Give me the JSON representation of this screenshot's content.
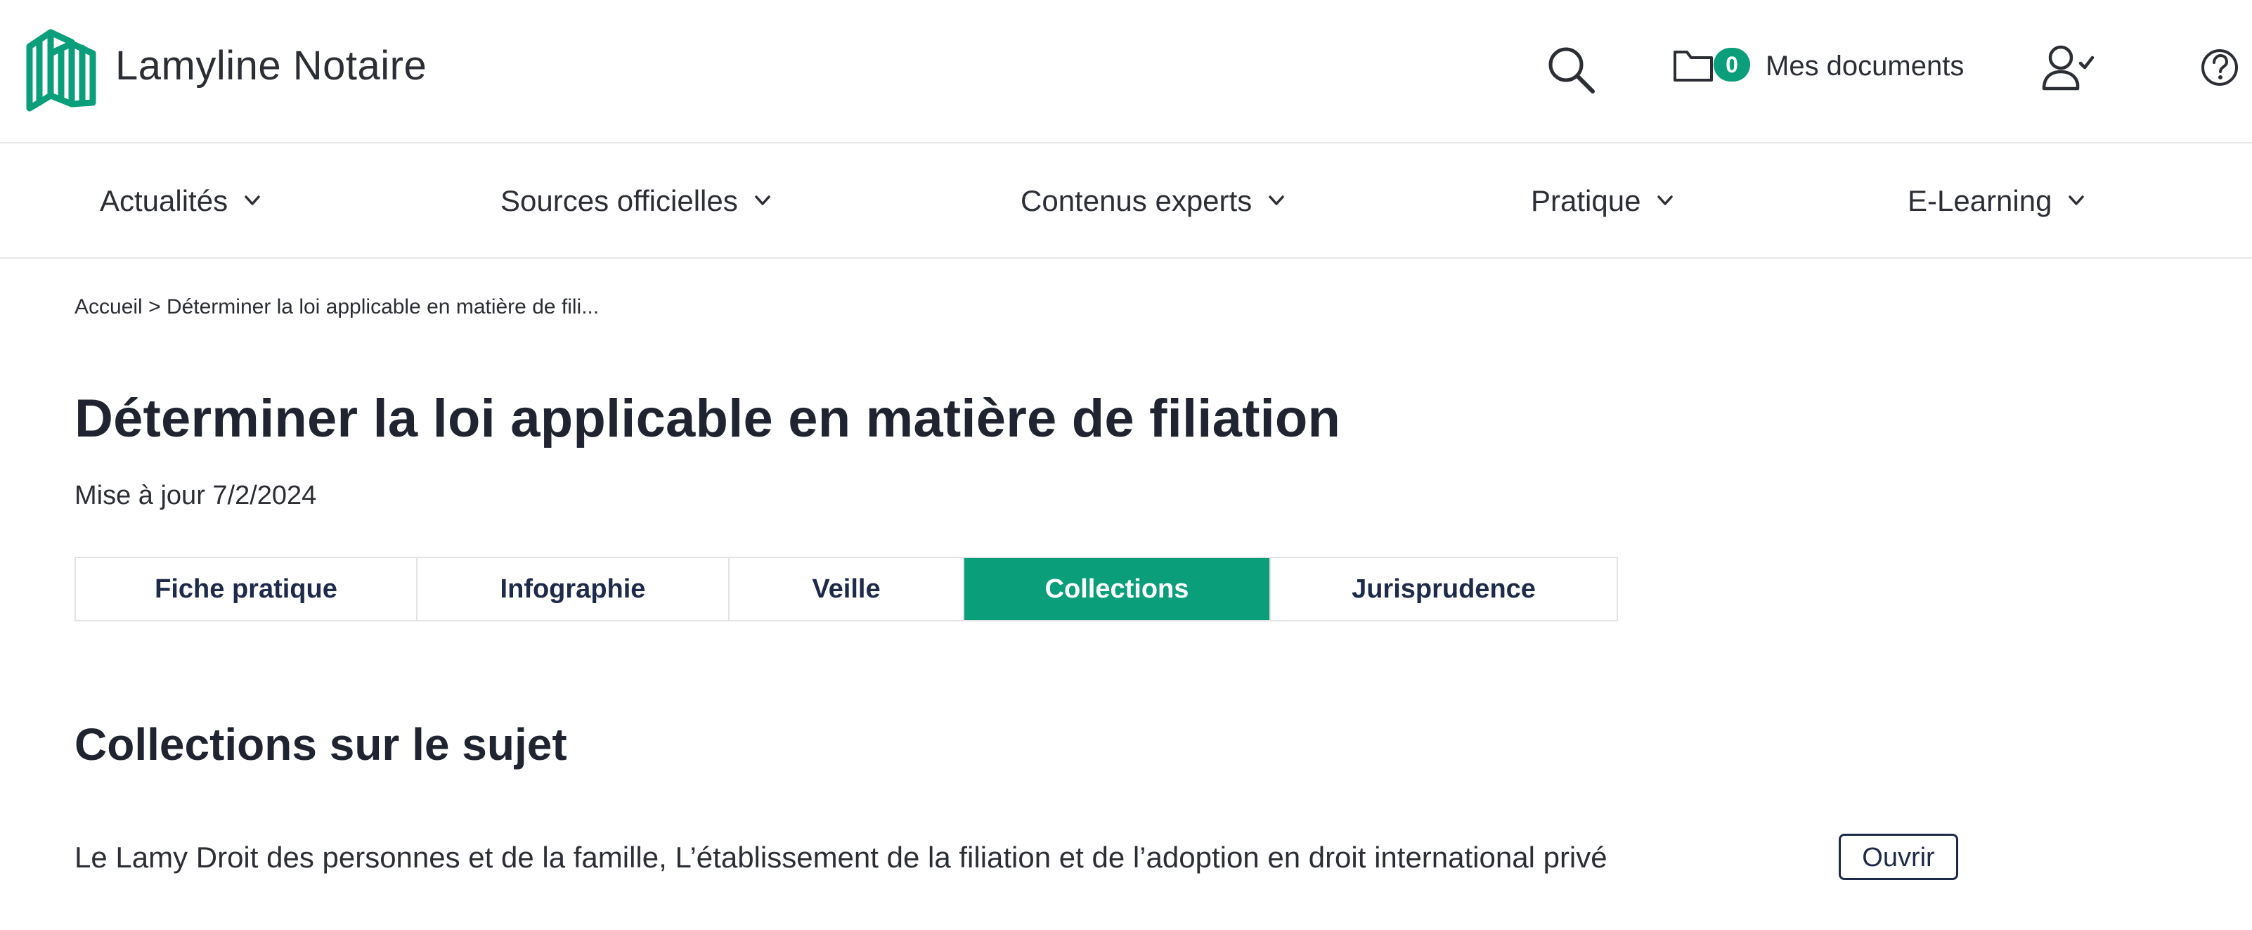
{
  "header": {
    "brand": "Lamyline Notaire",
    "docs_count": "0",
    "docs_label": "Mes documents",
    "icons": [
      "logo-icon",
      "search-icon",
      "folder-icon",
      "user-check-icon",
      "help-icon"
    ]
  },
  "nav": {
    "items": [
      {
        "label": "Actualités"
      },
      {
        "label": "Sources officielles"
      },
      {
        "label": "Contenus experts"
      },
      {
        "label": "Pratique"
      },
      {
        "label": "E-Learning"
      }
    ]
  },
  "breadcrumb": {
    "home": "Accueil",
    "separator": ">",
    "current": "Déterminer la loi applicable en matière de fili..."
  },
  "page": {
    "title": "Déterminer la loi applicable en matière de filiation",
    "updated": "Mise à jour 7/2/2024"
  },
  "tabs": {
    "items": [
      {
        "label": "Fiche pratique"
      },
      {
        "label": "Infographie"
      },
      {
        "label": "Veille"
      },
      {
        "label": "Collections"
      },
      {
        "label": "Jurisprudence"
      }
    ],
    "active_index": 3
  },
  "collections": {
    "heading": "Collections sur le sujet",
    "entries": [
      {
        "text": "Le Lamy Droit des personnes et de la famille, L’établissement de la filiation et de l’adoption en droit international privé",
        "button": "Ouvrir"
      }
    ]
  },
  "colors": {
    "accent": "#0a9f7a",
    "text": "#1f2430",
    "tab_text": "#1e2a4a",
    "divider": "#e6e6e6"
  }
}
